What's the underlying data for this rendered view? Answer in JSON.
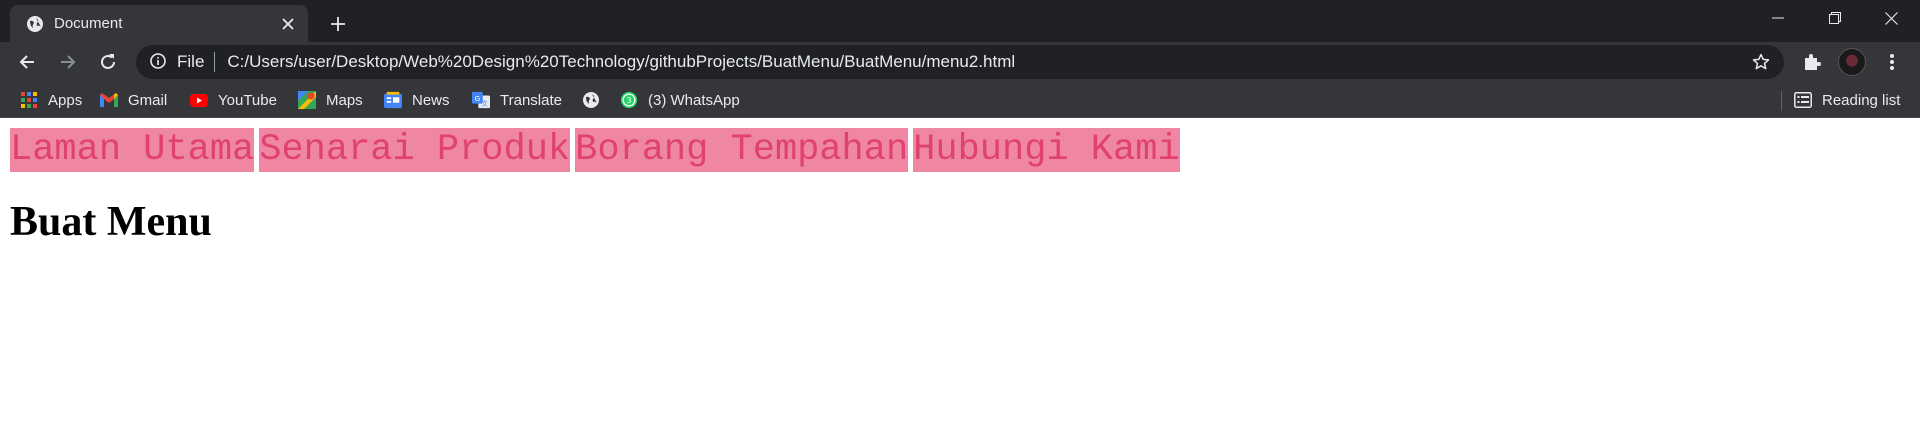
{
  "browser": {
    "tab": {
      "title": "Document",
      "favicon": "globe-icon"
    },
    "address": {
      "scheme": "File",
      "url": "C:/Users/user/Desktop/Web%20Design%20Technology/githubProjects/BuatMenu/BuatMenu/menu2.html"
    },
    "bookmarks": [
      {
        "label": "Apps",
        "icon": "apps-grid-icon"
      },
      {
        "label": "Gmail",
        "icon": "gmail-icon"
      },
      {
        "label": "YouTube",
        "icon": "youtube-icon"
      },
      {
        "label": "Maps",
        "icon": "maps-icon"
      },
      {
        "label": "News",
        "icon": "news-icon"
      },
      {
        "label": "Translate",
        "icon": "translate-icon"
      },
      {
        "label": "",
        "icon": "globe-icon"
      },
      {
        "label": "(3) WhatsApp",
        "icon": "whatsapp-icon",
        "badge": "3"
      }
    ],
    "reading_list": "Reading list"
  },
  "page": {
    "menu": [
      {
        "label": "Laman Utama"
      },
      {
        "label": "Senarai Produk"
      },
      {
        "label": "Borang Tempahan"
      },
      {
        "label": "Hubungi Kami"
      }
    ],
    "heading": "Buat Menu"
  },
  "colors": {
    "chrome_dark": "#202124",
    "chrome_mid": "#35363a",
    "menu_bg": "#ef87a3",
    "menu_text": "#e0416f"
  }
}
